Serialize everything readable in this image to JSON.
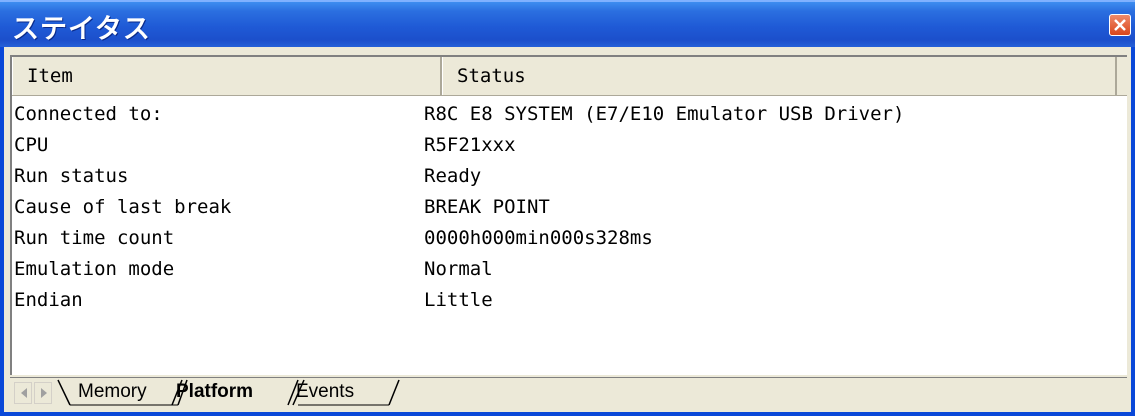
{
  "window": {
    "title": "ステイタス",
    "close_icon": "close-icon"
  },
  "table": {
    "columns": [
      "Item",
      "Status"
    ],
    "rows": [
      {
        "item": "Connected to:",
        "status": "R8C E8 SYSTEM (E7/E10 Emulator USB Driver)"
      },
      {
        "item": "CPU",
        "status": "R5F21xxx"
      },
      {
        "item": "Run status",
        "status": "Ready"
      },
      {
        "item": "Cause of last break",
        "status": "BREAK POINT"
      },
      {
        "item": "Run time count",
        "status": "0000h000min000s328ms"
      },
      {
        "item": "Emulation mode",
        "status": "Normal"
      },
      {
        "item": "Endian",
        "status": "Little"
      }
    ]
  },
  "tabs": {
    "items": [
      "Memory",
      "Platform",
      "Events"
    ],
    "active": "Platform"
  },
  "colors": {
    "titlebar": "#1f5ad6",
    "frame": "#0a48d8",
    "close_button": "#d9461b",
    "panel_bg": "#ece9d8"
  }
}
